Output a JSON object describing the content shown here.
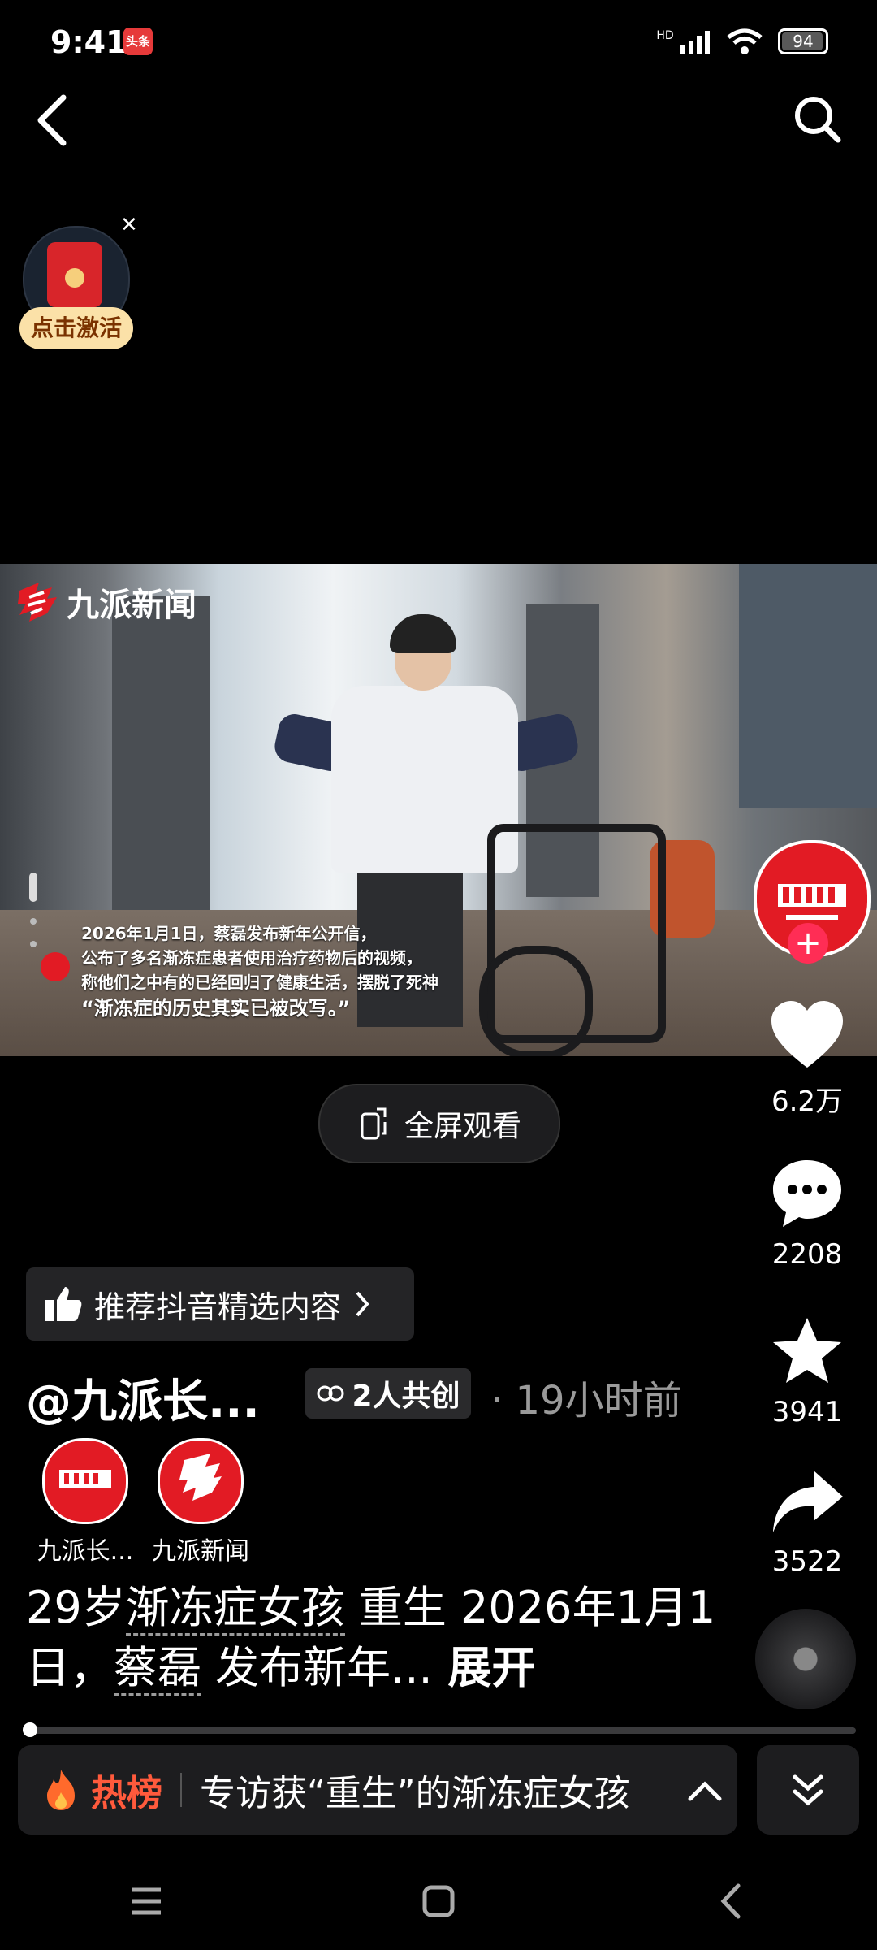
{
  "status": {
    "time": "9:41",
    "app_badge": "头条",
    "network": "HD",
    "battery": "94"
  },
  "video": {
    "logo": "九派新闻",
    "caption_lines": [
      "2026年1月1日，蔡磊发布新年公开信，",
      "公布了多名渐冻症患者使用治疗药物后的视频，",
      "称他们之中有的已经回归了健康生活，摆脱了死神"
    ],
    "caption_quote": "“渐冻症的历史其实已被改写。”"
  },
  "packet": {
    "label": "点击激活"
  },
  "fullscreen": {
    "label": "全屏观看"
  },
  "rail": {
    "likes": "6.2万",
    "comments": "2208",
    "favorites": "3941",
    "shares": "3522"
  },
  "recommend": {
    "label": "推荐抖音精选内容"
  },
  "author": {
    "name": "@九派长...",
    "cocreate": "2人共创",
    "time": "· 19小时前"
  },
  "cocreators": [
    {
      "name": "九派长..."
    },
    {
      "name": "九派新闻"
    }
  ],
  "description": {
    "part1": "29岁",
    "tag1": "渐冻症女孩",
    "part2": " 重生 2026年1月1日，",
    "tag2": "蔡磊",
    "part3": " 发布新年...",
    "expand": " 展开"
  },
  "hot": {
    "tag": "热榜",
    "text": "专访获“重生”的渐冻症女孩"
  },
  "colors": {
    "accent_red": "#e21b24",
    "hot": "#ff5a3c",
    "plus": "#ff2d55"
  }
}
